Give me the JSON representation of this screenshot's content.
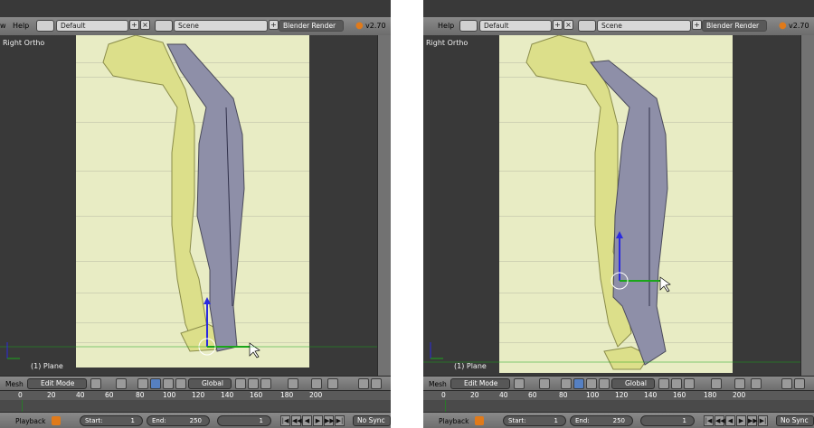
{
  "left": {
    "menu_view": "w",
    "menu_help": "Help",
    "layout_field": "Default",
    "scene_field": "Scene",
    "render_engine": "Blender Render",
    "version": "v2.70",
    "view_label": "Right Ortho",
    "object_label": "(1) Plane",
    "mode_menu": "Mesh",
    "mode_select": "Edit Mode",
    "orientation_select": "Global",
    "timeline_ticks": [
      "0",
      "20",
      "40",
      "60",
      "80",
      "100",
      "120",
      "140",
      "160",
      "180",
      "200"
    ],
    "playback_label": "Playback",
    "start_label": "Start:",
    "start_value": "1",
    "end_label": "End:",
    "end_value": "250",
    "current_frame": "1",
    "sync_select": "No Sync"
  },
  "right": {
    "menu_help": "Help",
    "layout_field": "Default",
    "scene_field": "Scene",
    "render_engine": "Blender Render",
    "version": "v2.70",
    "view_label": "Right Ortho",
    "object_label": "(1) Plane",
    "mode_menu": "Mesh",
    "mode_select": "Edit Mode",
    "orientation_select": "Global",
    "timeline_ticks": [
      "0",
      "20",
      "40",
      "60",
      "80",
      "100",
      "120",
      "140",
      "160",
      "180",
      "200"
    ],
    "playback_label": "Playback",
    "start_label": "Start:",
    "start_value": "1",
    "end_label": "End:",
    "end_value": "250",
    "current_frame": "1",
    "sync_select": "No Sync"
  },
  "colors": {
    "background": "#393939",
    "reference_paper": "#e8ecc4",
    "creature_fill": "#dcdf8a",
    "mesh_fill": "#8e8fa8",
    "axis_x": "#1aa61a",
    "axis_z": "#2a2ae0"
  }
}
